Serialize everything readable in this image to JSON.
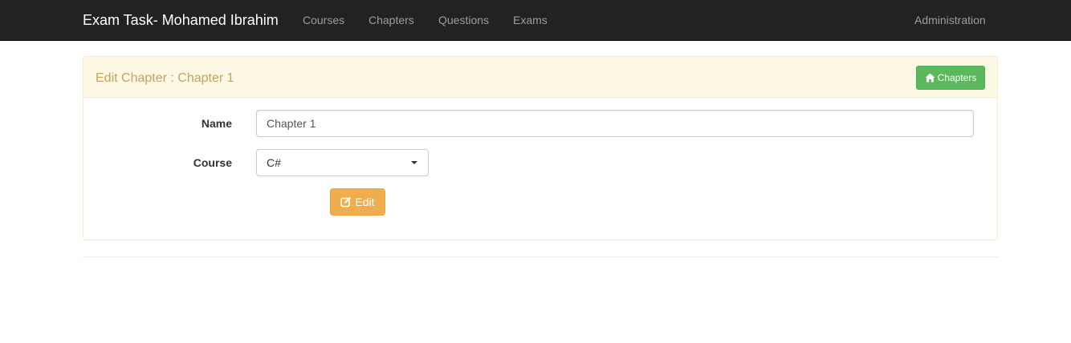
{
  "navbar": {
    "brand": "Exam Task- Mohamed Ibrahim",
    "links": [
      {
        "label": "Courses"
      },
      {
        "label": "Chapters"
      },
      {
        "label": "Questions"
      },
      {
        "label": "Exams"
      }
    ],
    "right_link": "Administration",
    "background_color": "#222222"
  },
  "panel": {
    "title": "Edit Chapter : Chapter 1",
    "back_button": {
      "label": "Chapters",
      "icon": "home-icon",
      "color": "#5cb85c"
    },
    "form": {
      "name_label": "Name",
      "name_value": "Chapter 1",
      "course_label": "Course",
      "course_selected": "C#",
      "submit_label": "Edit",
      "submit_icon": "edit-icon",
      "submit_color": "#f0ad4e"
    },
    "heading_color": "#fcf8e3",
    "title_color": "#c7a35f"
  }
}
